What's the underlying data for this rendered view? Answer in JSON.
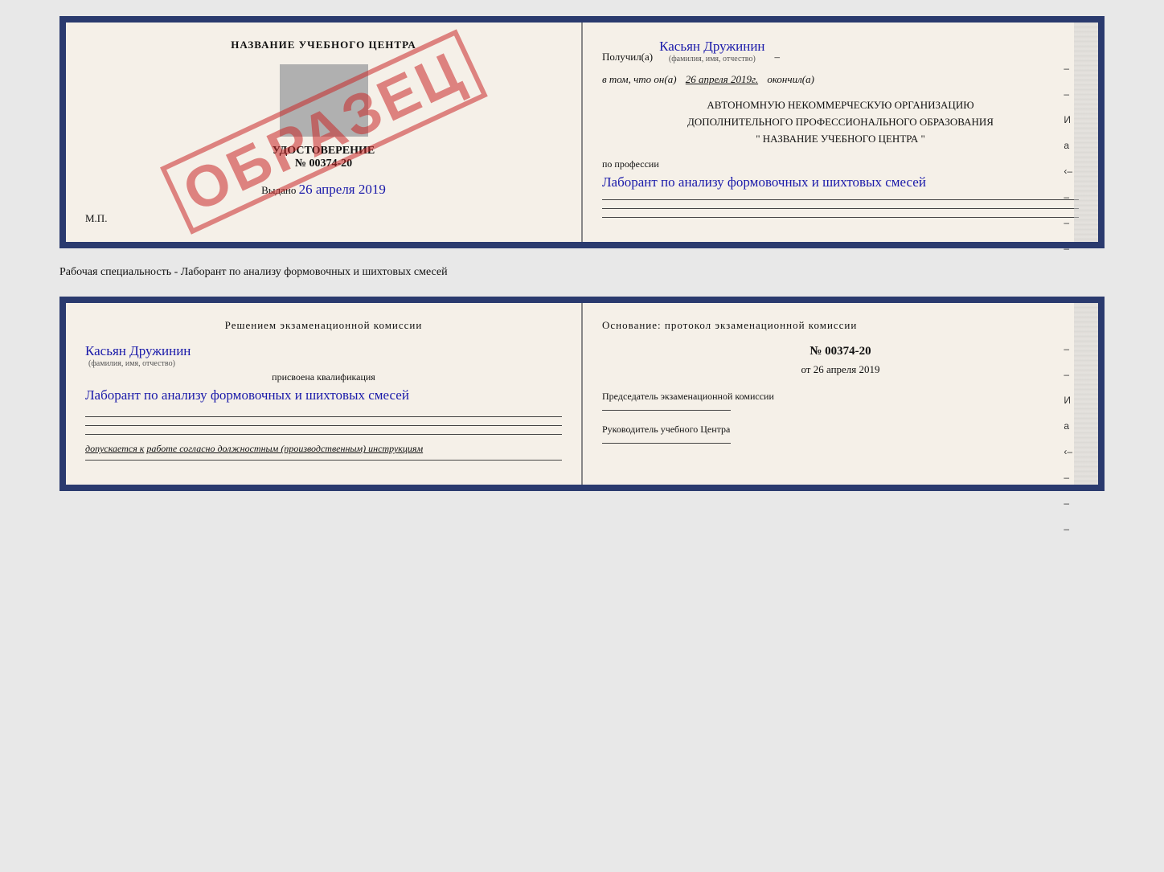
{
  "top": {
    "left": {
      "title": "НАЗВАНИЕ УЧЕБНОГО ЦЕНТРА",
      "cert_label": "УДОСТОВЕРЕНИЕ",
      "cert_number": "№ 00374-20",
      "issued_label": "Выдано",
      "issued_date": "26 апреля 2019",
      "mp_label": "М.П.",
      "obrazec": "ОБРАЗЕЦ"
    },
    "right": {
      "received_prefix": "Получил(а)",
      "received_name": "Касьян Дружинин",
      "received_fio_label": "(фамилия, имя, отчество)",
      "date_prefix": "в том, что он(а)",
      "date_value": "26 апреля 2019г.",
      "date_suffix": "окончил(а)",
      "org_line1": "АВТОНОМНУЮ НЕКОММЕРЧЕСКУЮ ОРГАНИЗАЦИЮ",
      "org_line2": "ДОПОЛНИТЕЛЬНОГО ПРОФЕССИОНАЛЬНОГО ОБРАЗОВАНИЯ",
      "org_line3": "\"   НАЗВАНИЕ УЧЕБНОГО ЦЕНТРА   \"",
      "profession_label": "по профессии",
      "profession_value": "Лаборант по анализу формовочных и шихтовых смесей"
    }
  },
  "separator": "Рабочая специальность - Лаборант по анализу формовочных и шихтовых смесей",
  "bottom": {
    "left": {
      "title": "Решением экзаменационной комиссии",
      "name_value": "Касьян Дружинин",
      "name_fio_label": "(фамилия, имя, отчество)",
      "qualification_label": "присвоена квалификация",
      "qualification_value": "Лаборант по анализу формовочных и шихтовых смесей",
      "допуск_prefix": "допускается к",
      "допуск_underline": "работе согласно должностным (производственным) инструкциям"
    },
    "right": {
      "osnov_title": "Основание: протокол экзаменационной комиссии",
      "number_value": "№ 00374-20",
      "date_prefix": "от",
      "date_value": "26 апреля 2019",
      "chairman_label": "Председатель экзаменационной комиссии",
      "director_label": "Руководитель учебного Центра"
    }
  }
}
